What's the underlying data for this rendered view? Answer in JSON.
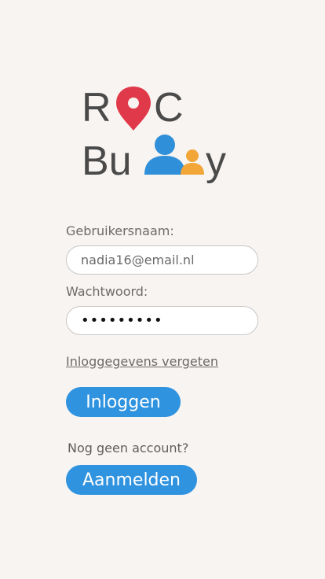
{
  "logo": {
    "line1": "RoC",
    "line2": "Buddy",
    "colors": {
      "text": "#4a4a4a",
      "pin": "#e03a4a",
      "person_large": "#2f8fd8",
      "person_small": "#f2a638"
    }
  },
  "form": {
    "username_label": "Gebruikersnaam:",
    "username_value": "nadia16@email.nl",
    "password_label": "Wachtwoord:",
    "password_value": "•••••••••",
    "forgot_link": "Inloggegevens vergeten",
    "login_button": "Inloggen"
  },
  "signup": {
    "prompt": "Nog geen account?",
    "register_button": "Aanmelden"
  },
  "colors": {
    "background": "#f8f4f1",
    "button": "#2f93e0",
    "label": "#6b6b6b"
  }
}
